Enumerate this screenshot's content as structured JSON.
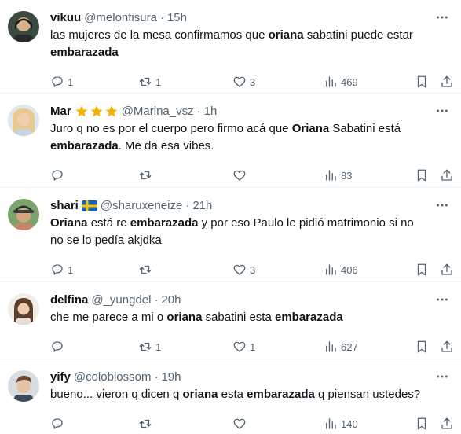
{
  "icons": {
    "reply": "reply-icon",
    "retweet": "retweet-icon",
    "like": "heart-icon",
    "views": "views-chart-icon",
    "bookmark": "bookmark-icon",
    "share": "share-icon",
    "more": "more-dots-icon"
  },
  "colors": {
    "text": "#0f1419",
    "muted": "#536471",
    "divider": "#eff3f4",
    "star": "#f5b400"
  },
  "tweets": [
    {
      "name": "vikuu",
      "handle": "@melonfisura",
      "time": "15h",
      "text_html": "las mujeres de la mesa confirmamos que <b>oriana</b> sabatini puede estar <b>embarazada</b>",
      "replies": "1",
      "retweets": "1",
      "likes": "3",
      "views": "469"
    },
    {
      "name": "Mar",
      "badge": "stars",
      "handle": "@Marina_vsz",
      "time": "1h",
      "text_html": "Juro q no es por el cuerpo pero firmo acá que <b>Oriana</b> Sabatini está <b>embarazada</b>. Me da esa vibes.",
      "replies": "",
      "retweets": "",
      "likes": "",
      "views": "83"
    },
    {
      "name": "shari",
      "badge": "flag-sweden",
      "handle": "@sharuxeneize",
      "time": "21h",
      "text_html": "<b>Oriana</b> está re <b>embarazada</b> y por eso Paulo le pidió matrimonio si no no se lo pedía akjdka",
      "replies": "1",
      "retweets": "",
      "likes": "3",
      "views": "406"
    },
    {
      "name": "delfina",
      "handle": "@_yungdel",
      "time": "20h",
      "text_html": "che me parece a mi o <b>oriana</b> sabatini esta <b>embarazada</b>",
      "replies": "",
      "retweets": "1",
      "likes": "1",
      "views": "627"
    },
    {
      "name": "yify",
      "handle": "@coloblossom",
      "time": "19h",
      "text_html": "bueno... vieron q dicen q <b>oriana</b> esta <b>embarazada</b> q piensan ustedes?",
      "replies": "",
      "retweets": "",
      "likes": "",
      "views": "140"
    }
  ]
}
